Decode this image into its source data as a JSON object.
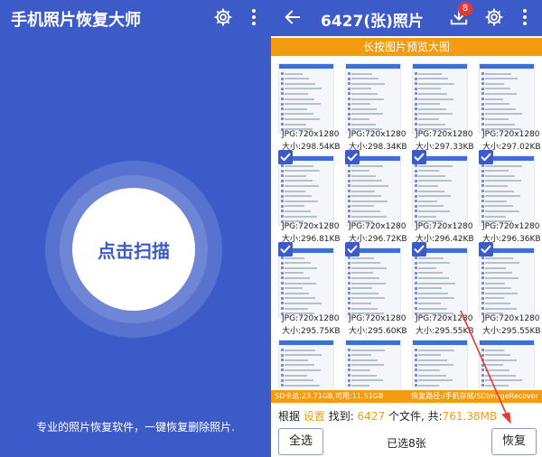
{
  "left": {
    "title": "手机照片恢复大师",
    "scan_label": "点击扫描",
    "description": "专业的照片恢复软件，一键恢复删除照片.",
    "icons": [
      "gear-icon",
      "more-vert-icon"
    ]
  },
  "right": {
    "title": "6427(张)照片",
    "download_badge": "8",
    "icons": [
      "back-arrow-icon",
      "download-icon",
      "gear-icon",
      "more-vert-icon"
    ],
    "banner": "长按图片预览大图",
    "photos": [
      {
        "format": "JPG:720x1280",
        "size": "大小:298.54KB",
        "checked": false
      },
      {
        "format": "JPG:720x1280",
        "size": "大小:298.34KB",
        "checked": false
      },
      {
        "format": "JPG:720x1280",
        "size": "大小:297.33KB",
        "checked": false
      },
      {
        "format": "JPG:720x1280",
        "size": "大小:297.02KB",
        "checked": false
      },
      {
        "format": "JPG:720x1280",
        "size": "大小:296.81KB",
        "checked": true
      },
      {
        "format": "JPG:720x1280",
        "size": "大小:296.72KB",
        "checked": true
      },
      {
        "format": "JPG:720x1280",
        "size": "大小:296.42KB",
        "checked": true
      },
      {
        "format": "JPG:720x1280",
        "size": "大小:296.36KB",
        "checked": true
      },
      {
        "format": "JPG:720x1280",
        "size": "大小:295.75KB",
        "checked": true
      },
      {
        "format": "JPG:720x1280",
        "size": "大小:295.60KB",
        "checked": true
      },
      {
        "format": "JPG:720x1280",
        "size": "大小:295.55KB",
        "checked": true
      },
      {
        "format": "JPG:720x1280",
        "size": "大小:295.55KB",
        "checked": true
      },
      {
        "format": "",
        "size": "",
        "checked": false
      },
      {
        "format": "",
        "size": "",
        "checked": false
      },
      {
        "format": "",
        "size": "",
        "checked": false
      },
      {
        "format": "",
        "size": "",
        "checked": false
      }
    ],
    "sd_info": "SD卡总:23.71GB,可用:11.51GB",
    "path_info": "恢复路径:/手机存储/SDImageRecover",
    "found": {
      "prefix": "根据",
      "settings_link": "设置",
      "found_label": "找到:",
      "count": "6427",
      "middle": "个文件, 共:",
      "total_size": "761.38MB"
    },
    "select_all_label": "全选",
    "selected_text": "已选8张",
    "recover_label": "恢复"
  },
  "colors": {
    "primary": "#3d5bc8",
    "accent": "#f39c12",
    "badge": "#e53935",
    "arrow": "#e53935"
  }
}
